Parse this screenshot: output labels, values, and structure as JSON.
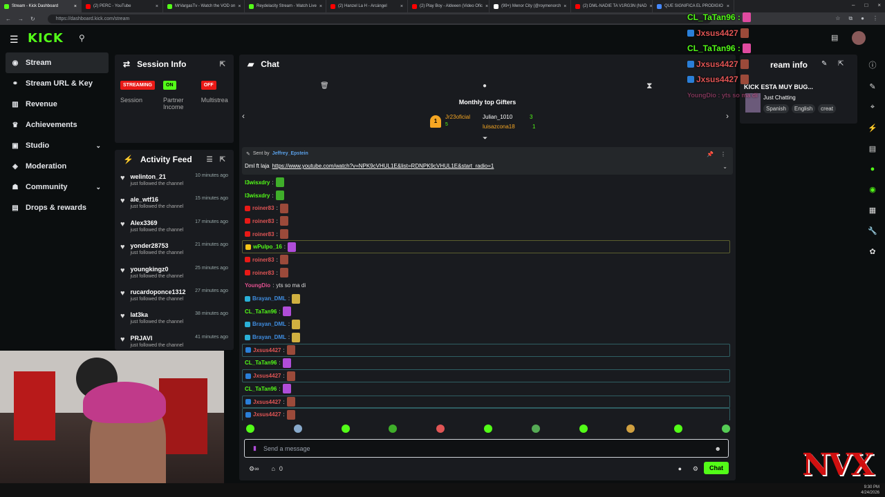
{
  "browser": {
    "tabs": [
      {
        "title": "Stream - Kick Dashboard",
        "color": "#53fc18",
        "active": true
      },
      {
        "title": "(2) PERC - YouTube",
        "color": "#ff0000"
      },
      {
        "title": "MrVargasTv - Watch the VOD on",
        "color": "#53fc18"
      },
      {
        "title": "Reydelacity Stream - Watch Live",
        "color": "#53fc18"
      },
      {
        "title": "(2) Hanzel La H - Arcángel",
        "color": "#ff0000"
      },
      {
        "title": "(2) Play Boy - Aldeeen (Video Ofic",
        "color": "#ff0000"
      },
      {
        "title": "(99+) Menor City (@roymenorch",
        "color": "#ffffff"
      },
      {
        "title": "(2) DML-NADIE TA V1RG3N (NAD",
        "color": "#ff0000"
      },
      {
        "title": "QUE SIGNIFICA EL PRODIGIO",
        "color": "#4488ff"
      }
    ],
    "url": "https://dashboard.kick.com/stream"
  },
  "header": {
    "logo": "KICK"
  },
  "sidebar": {
    "items": [
      {
        "label": "Stream",
        "icon": "broadcast-icon"
      },
      {
        "label": "Stream URL & Key",
        "icon": "link-icon"
      },
      {
        "label": "Revenue",
        "icon": "chart-icon"
      },
      {
        "label": "Achievements",
        "icon": "trophy-icon"
      },
      {
        "label": "Studio",
        "icon": "camera-icon"
      },
      {
        "label": "Moderation",
        "icon": "shield-icon"
      },
      {
        "label": "Community",
        "icon": "users-icon"
      },
      {
        "label": "Drops & rewards",
        "icon": "gift-icon"
      }
    ]
  },
  "session": {
    "title": "Session Info",
    "columns": [
      {
        "badge": "STREAMING",
        "badge_color": "#e91916",
        "label": "Session"
      },
      {
        "badge": "ON",
        "badge_color": "#53fc18",
        "label": "Partner Income"
      },
      {
        "badge": "OFF",
        "badge_color": "#e91916",
        "label": "Multistrea"
      }
    ]
  },
  "activity": {
    "title": "Activity Feed",
    "items": [
      {
        "user": "welinton_21",
        "time": "10 minutes ago",
        "text": "just followed the channel"
      },
      {
        "user": "ale_wtf16",
        "time": "15 minutes ago",
        "text": "just followed the channel"
      },
      {
        "user": "Alex3369",
        "time": "17 minutes ago",
        "text": "just followed the channel"
      },
      {
        "user": "yonder28753",
        "time": "21 minutes ago",
        "text": "just followed the channel"
      },
      {
        "user": "youngkingz0",
        "time": "25 minutes ago",
        "text": "just followed the channel"
      },
      {
        "user": "rucardoponce1312",
        "time": "27 minutes ago",
        "text": "just followed the channel"
      },
      {
        "user": "lat3ka",
        "time": "38 minutes ago",
        "text": "just followed the channel"
      },
      {
        "user": "PRJAVI",
        "time": "41 minutes ago",
        "text": "just followed the channel"
      }
    ]
  },
  "chat": {
    "title": "Chat",
    "gifters_title": "Monthly top Gifters",
    "gifters": [
      {
        "rank": "1",
        "name": "Jr23oficial",
        "count": "5"
      },
      {
        "name": "Julian_1010",
        "count": "3"
      },
      {
        "name": "luisazcona18",
        "count": "1"
      }
    ],
    "pinned": {
      "sent_by_label": "Sent by",
      "author": "Jeffrey_Epstein",
      "prefix": "Dml ft laja",
      "link": "https://www.youtube.com/watch?v=NPK9cVHUL1E&list=RDNPK9cVHUL1E&start_radio=1"
    },
    "messages": [
      {
        "user": "l3wisxdry",
        "color": "#53fc18",
        "text": "",
        "emote": "#3fae2a"
      },
      {
        "user": "l3wisxdry",
        "color": "#53fc18",
        "text": "",
        "emote": "#3fae2a"
      },
      {
        "user": "roiner83",
        "color": "#e05555",
        "text": "",
        "emote": "#9b4a3a",
        "badge": "#e91916"
      },
      {
        "user": "roiner83",
        "color": "#e05555",
        "text": "",
        "emote": "#9b4a3a",
        "badge": "#e91916"
      },
      {
        "user": "roiner83",
        "color": "#e05555",
        "text": "",
        "emote": "#9b4a3a",
        "badge": "#e91916"
      },
      {
        "user": "wPulpo_16",
        "color": "#53fc18",
        "text": "",
        "emote": "#b04dd8",
        "badge": "#f5c518",
        "hl": "hl"
      },
      {
        "user": "roiner83",
        "color": "#e05555",
        "text": "",
        "emote": "#9b4a3a",
        "badge": "#e91916"
      },
      {
        "user": "roiner83",
        "color": "#e05555",
        "text": "",
        "emote": "#9b4a3a",
        "badge": "#e91916"
      },
      {
        "user": "YoungDio",
        "color": "#e0508f",
        "text": "yts so ma di",
        "emote": ""
      },
      {
        "user": "Brayan_DML",
        "color": "#3f8de0",
        "text": "",
        "emote": "#d0b040",
        "badge": "#2ab0d8"
      },
      {
        "user": "CL_TaTan96",
        "color": "#53fc18",
        "text": "",
        "emote": "#b04dd8"
      },
      {
        "user": "Brayan_DML",
        "color": "#3f8de0",
        "text": "",
        "emote": "#d0b040",
        "badge": "#2ab0d8"
      },
      {
        "user": "Brayan_DML",
        "color": "#3f8de0",
        "text": "",
        "emote": "#d0b040",
        "badge": "#2ab0d8"
      },
      {
        "user": "Jxsus4427",
        "color": "#e05555",
        "text": "",
        "emote": "#9b4a3a",
        "badge": "#2a7fd8",
        "hl": "hl2"
      },
      {
        "user": "CL_TaTan96",
        "color": "#53fc18",
        "text": "",
        "emote": "#b04dd8"
      },
      {
        "user": "Jxsus4427",
        "color": "#e05555",
        "text": "",
        "emote": "#9b4a3a",
        "badge": "#2a7fd8",
        "hl": "hl2"
      },
      {
        "user": "CL_TaTan96",
        "color": "#53fc18",
        "text": "",
        "emote": "#b04dd8"
      },
      {
        "user": "Jxsus4427",
        "color": "#e05555",
        "text": "",
        "emote": "#9b4a3a",
        "badge": "#2a7fd8",
        "hl": "hl2"
      },
      {
        "user": "Jxsus4427",
        "color": "#e05555",
        "text": "",
        "emote": "#9b4a3a",
        "badge": "#2a7fd8",
        "hl": "hl2"
      }
    ],
    "emote_colors": [
      "#53fc18",
      "#8ac",
      ".",
      "#3fae2a",
      "#e05555",
      "#53fc18",
      "#5a5",
      "#53fc18",
      "#d0a040",
      "#53fc18",
      "#5c5"
    ],
    "send_placeholder": "Send a message",
    "viewer_count": "0",
    "chat_button": "Chat"
  },
  "stream_info": {
    "title_visible": "ream info",
    "stream_title": "KICK ESTA MUY BUG...",
    "category": "Just Chatting",
    "tags": [
      "Spanish",
      "English",
      "creat"
    ]
  },
  "overlay": {
    "lines": [
      {
        "user": "CL_TaTan96 :",
        "color": "#53fc18"
      },
      {
        "user": "Jxsus4427",
        "color": "#e05555"
      },
      {
        "user": "CL_TaTan96 :",
        "color": "#53fc18"
      },
      {
        "user": "Jxsus4427",
        "color": "#e05555"
      },
      {
        "user": "Jxsus4427",
        "color": "#e05555"
      },
      {
        "user": "YoungDio : yts so ma di",
        "color": "#e0508f"
      }
    ]
  },
  "watermark": "NVX",
  "clock": {
    "time": "9:30 PM",
    "date": "4/24/2026"
  }
}
